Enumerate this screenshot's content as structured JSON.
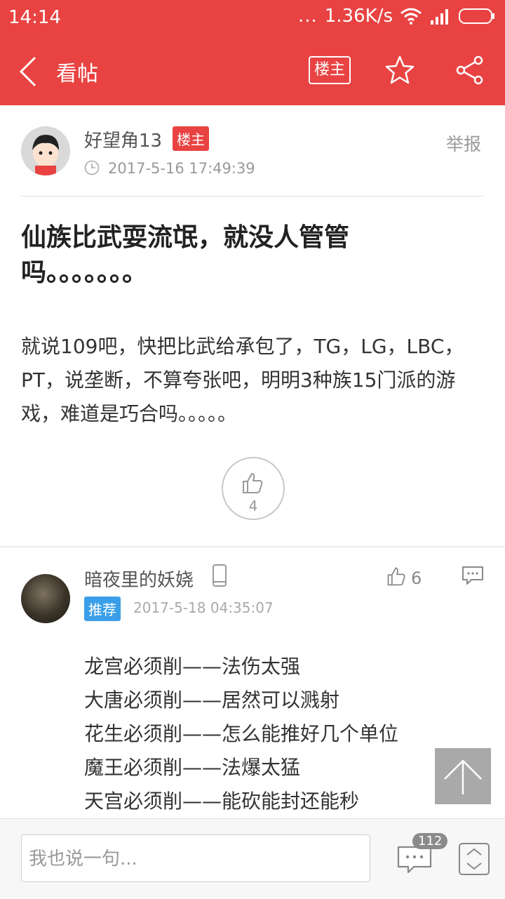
{
  "status": {
    "time": "14:14",
    "speed": "1.36K/s",
    "dots": "..."
  },
  "appbar": {
    "title": "看帖",
    "louzhu_button": "楼主"
  },
  "post": {
    "author": "好望角13",
    "author_badge": "楼主",
    "time": "2017-5-16 17:49:39",
    "report": "举报",
    "title": "仙族比武耍流氓，就没人管管吗。。。。。。。",
    "body": "就说109吧，快把比武给承包了，TG，LG，LBC，PT，说垄断，不算夸张吧，明明3种族15门派的游戏，难道是巧合吗。。。。。",
    "likes": "4"
  },
  "reply": {
    "author": "暗夜里的妖娆",
    "badge": "推荐",
    "time": "2017-5-18 04:35:07",
    "likes": "6",
    "lines": [
      "龙宫必须削——法伤太强",
      "大唐必须削——居然可以溅射",
      "花生必须削——怎么能推好几个单位",
      "魔王必须削——法爆太猛",
      "天宫必须削——能砍能封还能秒"
    ]
  },
  "bottom": {
    "placeholder": "我也说一句...",
    "comment_count": "112"
  },
  "colors": {
    "brand": "#e84342",
    "recommend": "#3a9fe8"
  }
}
